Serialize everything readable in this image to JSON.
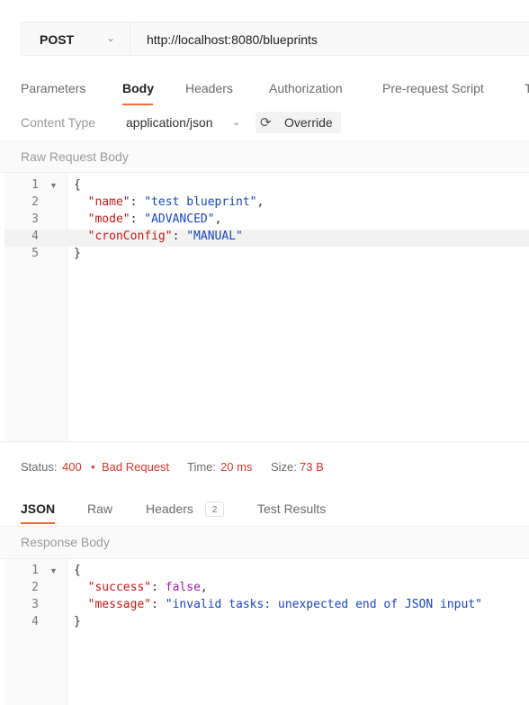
{
  "request": {
    "method": "POST",
    "url": "http://localhost:8080/blueprints"
  },
  "request_tabs": [
    {
      "label": "Parameters"
    },
    {
      "label": "Body"
    },
    {
      "label": "Headers"
    },
    {
      "label": "Authorization"
    },
    {
      "label": "Pre-request Script"
    },
    {
      "label": "T"
    }
  ],
  "content_type": {
    "label": "Content Type",
    "value": "application/json",
    "override_label": "Override"
  },
  "raw_request_body": {
    "title": "Raw Request Body",
    "line_numbers": [
      "1",
      "2",
      "3",
      "4",
      "5"
    ],
    "lines": [
      [
        {
          "t": "{",
          "c": "p"
        }
      ],
      [
        {
          "t": "  ",
          "c": "p"
        },
        {
          "t": "\"name\"",
          "c": "key"
        },
        {
          "t": ": ",
          "c": "p"
        },
        {
          "t": "\"test blueprint\"",
          "c": "str"
        },
        {
          "t": ",",
          "c": "p"
        }
      ],
      [
        {
          "t": "  ",
          "c": "p"
        },
        {
          "t": "\"mode\"",
          "c": "key"
        },
        {
          "t": ": ",
          "c": "p"
        },
        {
          "t": "\"ADVANCED\"",
          "c": "str"
        },
        {
          "t": ",",
          "c": "p"
        }
      ],
      [
        {
          "t": "  ",
          "c": "p"
        },
        {
          "t": "\"cronConfig\"",
          "c": "key"
        },
        {
          "t": ": ",
          "c": "p"
        },
        {
          "t": "\"MANUAL\"",
          "c": "str"
        }
      ],
      [
        {
          "t": "}",
          "c": "p"
        }
      ]
    ]
  },
  "status": {
    "status_label": "Status:",
    "code": "400",
    "bullet": "•",
    "text": "Bad Request",
    "time_label": "Time:",
    "time_value": "20 ms",
    "size_label": "Size:",
    "size_value": "73 B"
  },
  "response_tabs": [
    {
      "label": "JSON"
    },
    {
      "label": "Raw"
    },
    {
      "label": "Headers",
      "badge": "2"
    },
    {
      "label": "Test Results"
    }
  ],
  "response_body": {
    "title": "Response Body",
    "line_numbers": [
      "1",
      "2",
      "3",
      "4"
    ],
    "lines": [
      [
        {
          "t": "{",
          "c": "p"
        }
      ],
      [
        {
          "t": "  ",
          "c": "p"
        },
        {
          "t": "\"success\"",
          "c": "key"
        },
        {
          "t": ": ",
          "c": "p"
        },
        {
          "t": "false",
          "c": "bool"
        },
        {
          "t": ",",
          "c": "p"
        }
      ],
      [
        {
          "t": "  ",
          "c": "p"
        },
        {
          "t": "\"message\"",
          "c": "key"
        },
        {
          "t": ": ",
          "c": "p"
        },
        {
          "t": "\"invalid tasks: unexpected end of JSON input\"",
          "c": "str"
        }
      ],
      [
        {
          "t": "}",
          "c": "p"
        }
      ]
    ]
  },
  "icons": {
    "method_dropdown": "chevron-down-icon",
    "content_type_dropdown": "chevron-down-icon",
    "override": "refresh-icon",
    "fold": "fold-caret-icon"
  },
  "colors": {
    "accent": "#f26b3a",
    "error": "#e0352b",
    "json_key": "#c41a16",
    "json_string": "#1a45c4",
    "json_boolean": "#a31aa8"
  }
}
